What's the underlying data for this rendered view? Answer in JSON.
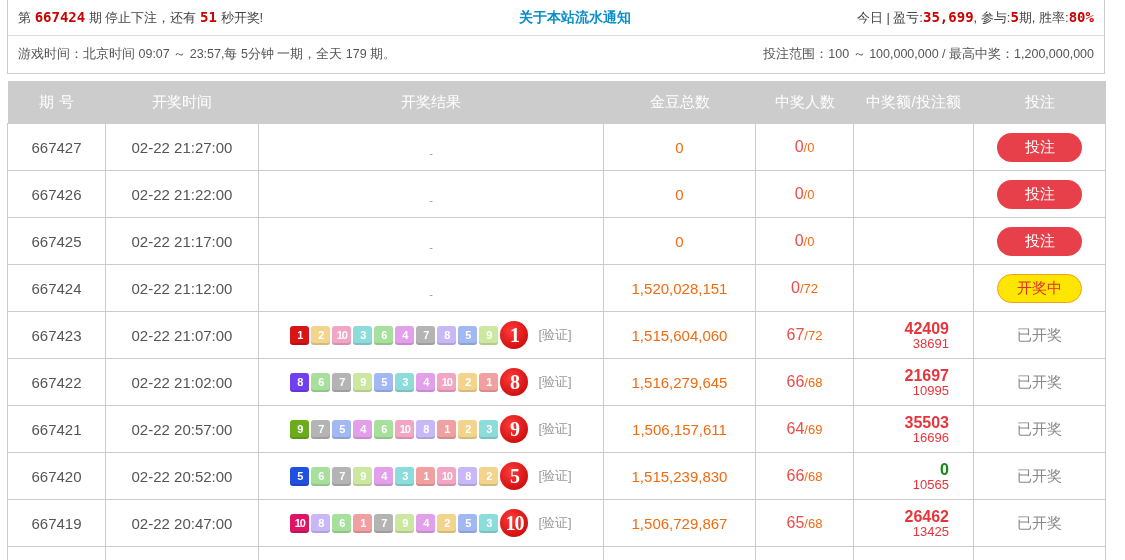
{
  "info": {
    "countdown": "第 **667424** 期 停止下注，还有 **51** 秒开奖!",
    "notice_link": "关于本站流水通知",
    "today": "今日 | 盈亏:**35,699**, 参与:**5**期, 胜率:**80%**",
    "schedule": "游戏时间：北京时间 09:07 ～ 23:57,每 5分钟 一期，全天 179 期。",
    "range": "投注范围：100 ～ 100,000,000 / 最高中奖：1,200,000,000"
  },
  "table": {
    "columns": [
      "期 号",
      "开奖时间",
      "开奖结果",
      "金豆总数",
      "中奖人数",
      "中奖额/投注额",
      "投注"
    ],
    "rows": [
      {
        "issue": "667427",
        "time": "02-22 21:27:00",
        "result_placeholder": "-",
        "pool": "0",
        "winners": "0",
        "players": "/0",
        "action": {
          "kind": "bet",
          "label": "投注"
        }
      },
      {
        "issue": "667426",
        "time": "02-22 21:22:00",
        "result_placeholder": "-",
        "pool": "0",
        "winners": "0",
        "players": "/0",
        "action": {
          "kind": "bet",
          "label": "投注"
        }
      },
      {
        "issue": "667425",
        "time": "02-22 21:17:00",
        "result_placeholder": "-",
        "pool": "0",
        "winners": "0",
        "players": "/0",
        "action": {
          "kind": "bet",
          "label": "投注"
        }
      },
      {
        "issue": "667424",
        "time": "02-22 21:12:00",
        "result_placeholder": "-",
        "pool": "1,520,028,151",
        "winners": "0",
        "players": "/72",
        "action": {
          "kind": "drawing",
          "label": "开奖中"
        }
      },
      {
        "issue": "667423",
        "time": "02-22 21:07:00",
        "balls": [
          {
            "n": "1",
            "color": "#d81414"
          },
          {
            "n": "2",
            "color": "#f3d48c"
          },
          {
            "n": "10",
            "color": "#f3a6c4"
          },
          {
            "n": "3",
            "color": "#8cdcdc"
          },
          {
            "n": "6",
            "color": "#a6e09c"
          },
          {
            "n": "4",
            "color": "#e2a0ea"
          },
          {
            "n": "7",
            "color": "#b4b4b4"
          },
          {
            "n": "8",
            "color": "#c8b8f8"
          },
          {
            "n": "5",
            "color": "#a2b8f2"
          },
          {
            "n": "9",
            "color": "#cce8a0"
          }
        ],
        "result": "1",
        "verify": "[验证]",
        "pool": "1,515,604,060",
        "winners": "67",
        "players": "/72",
        "ratio": {
          "win": "42409",
          "bet": "38691",
          "color": "#e8343c"
        },
        "action": {
          "kind": "done",
          "label": "已开奖"
        }
      },
      {
        "issue": "667422",
        "time": "02-22 21:02:00",
        "balls": [
          {
            "n": "8",
            "color": "#7040f0"
          },
          {
            "n": "6",
            "color": "#a6e09c"
          },
          {
            "n": "7",
            "color": "#b4b4b4"
          },
          {
            "n": "9",
            "color": "#cce8a0"
          },
          {
            "n": "5",
            "color": "#a2b8f2"
          },
          {
            "n": "3",
            "color": "#8cdcdc"
          },
          {
            "n": "4",
            "color": "#e2a0ea"
          },
          {
            "n": "10",
            "color": "#f3a6c4"
          },
          {
            "n": "2",
            "color": "#f3d48c"
          },
          {
            "n": "1",
            "color": "#f0a0a0"
          }
        ],
        "result": "8",
        "verify": "[验证]",
        "pool": "1,516,279,645",
        "winners": "66",
        "players": "/68",
        "ratio": {
          "win": "21697",
          "bet": "10995",
          "color": "#e8343c"
        },
        "action": {
          "kind": "done",
          "label": "已开奖"
        }
      },
      {
        "issue": "667421",
        "time": "02-22 20:57:00",
        "balls": [
          {
            "n": "9",
            "color": "#6cac1c"
          },
          {
            "n": "7",
            "color": "#b4b4b4"
          },
          {
            "n": "5",
            "color": "#a2b8f2"
          },
          {
            "n": "4",
            "color": "#e2a0ea"
          },
          {
            "n": "6",
            "color": "#a6e09c"
          },
          {
            "n": "10",
            "color": "#f3a6c4"
          },
          {
            "n": "8",
            "color": "#c8b8f8"
          },
          {
            "n": "1",
            "color": "#f0a0a0"
          },
          {
            "n": "2",
            "color": "#f3d48c"
          },
          {
            "n": "3",
            "color": "#8cdcdc"
          }
        ],
        "result": "9",
        "verify": "[验证]",
        "pool": "1,506,157,611",
        "winners": "64",
        "players": "/69",
        "ratio": {
          "win": "35503",
          "bet": "16696",
          "color": "#e8343c"
        },
        "action": {
          "kind": "done",
          "label": "已开奖"
        }
      },
      {
        "issue": "667420",
        "time": "02-22 20:52:00",
        "balls": [
          {
            "n": "5",
            "color": "#2050e0"
          },
          {
            "n": "6",
            "color": "#a6e09c"
          },
          {
            "n": "7",
            "color": "#b4b4b4"
          },
          {
            "n": "9",
            "color": "#cce8a0"
          },
          {
            "n": "4",
            "color": "#e2a0ea"
          },
          {
            "n": "3",
            "color": "#8cdcdc"
          },
          {
            "n": "1",
            "color": "#f0a0a0"
          },
          {
            "n": "10",
            "color": "#f3a6c4"
          },
          {
            "n": "8",
            "color": "#c8b8f8"
          },
          {
            "n": "2",
            "color": "#f3d48c"
          }
        ],
        "result": "5",
        "verify": "[验证]",
        "pool": "1,515,239,830",
        "winners": "66",
        "players": "/68",
        "ratio": {
          "win": "0",
          "bet": "10565",
          "color": "#108a10"
        },
        "action": {
          "kind": "done",
          "label": "已开奖"
        }
      },
      {
        "issue": "667419",
        "time": "02-22 20:47:00",
        "balls": [
          {
            "n": "10",
            "color": "#e01464"
          },
          {
            "n": "8",
            "color": "#c8b8f8"
          },
          {
            "n": "6",
            "color": "#a6e09c"
          },
          {
            "n": "1",
            "color": "#f0a0a0"
          },
          {
            "n": "7",
            "color": "#b4b4b4"
          },
          {
            "n": "9",
            "color": "#cce8a0"
          },
          {
            "n": "4",
            "color": "#e2a0ea"
          },
          {
            "n": "2",
            "color": "#f3d48c"
          },
          {
            "n": "5",
            "color": "#a2b8f2"
          },
          {
            "n": "3",
            "color": "#8cdcdc"
          }
        ],
        "result": "10",
        "verify": "[验证]",
        "pool": "1,506,729,867",
        "winners": "65",
        "players": "/68",
        "ratio": {
          "win": "26462",
          "bet": "13425",
          "color": "#e8343c"
        },
        "action": {
          "kind": "done",
          "label": "已开奖"
        }
      }
    ]
  }
}
